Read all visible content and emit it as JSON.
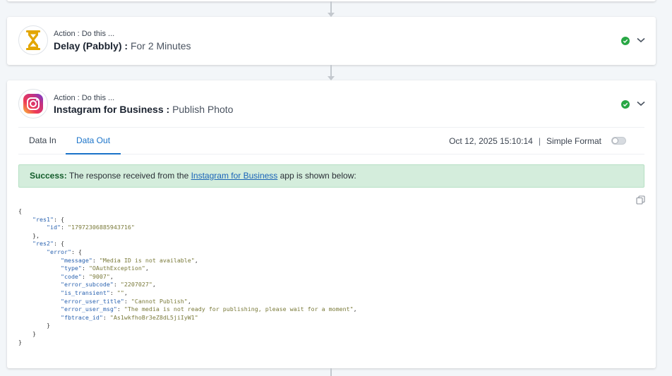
{
  "steps": [
    {
      "kicker": "Action : Do this ...",
      "app_name": "Delay (Pabbly)",
      "separator": " : ",
      "action_name": "For 2 Minutes",
      "icon": "hourglass-icon",
      "status": "success"
    },
    {
      "kicker": "Action : Do this ...",
      "app_name": "Instagram for Business",
      "separator": " : ",
      "action_name": "Publish Photo",
      "icon": "instagram-icon",
      "status": "success"
    }
  ],
  "tabs": [
    {
      "label": "Data In",
      "active": false
    },
    {
      "label": "Data Out",
      "active": true
    }
  ],
  "meta": {
    "timestamp": "Oct 12, 2025 15:10:14",
    "separator": "|",
    "format_label": "Simple Format",
    "simple_format_on": false
  },
  "alert": {
    "lead": "Success:",
    "text_before": " The response received from the ",
    "link": "Instagram for Business",
    "text_after": " app is shown below:"
  },
  "response": [
    {
      "indent": 0,
      "text": "{"
    },
    {
      "indent": 1,
      "key": "res1",
      "text": ": {"
    },
    {
      "indent": 2,
      "key": "id",
      "value": "17972306885943716"
    },
    {
      "indent": 1,
      "text": "},"
    },
    {
      "indent": 1,
      "key": "res2",
      "text": ": {"
    },
    {
      "indent": 2,
      "key": "error",
      "text": ": {"
    },
    {
      "indent": 3,
      "key": "message",
      "value": "Media ID is not available",
      "comma": true
    },
    {
      "indent": 3,
      "key": "type",
      "value": "OAuthException",
      "comma": true
    },
    {
      "indent": 3,
      "key": "code",
      "value": "9007",
      "comma": true
    },
    {
      "indent": 3,
      "key": "error_subcode",
      "value": "2207027",
      "comma": true
    },
    {
      "indent": 3,
      "key": "is_transient",
      "value": "",
      "comma": true
    },
    {
      "indent": 3,
      "key": "error_user_title",
      "value": "Cannot Publish",
      "comma": true
    },
    {
      "indent": 3,
      "key": "error_user_msg",
      "value": "The media is not ready for publishing, please wait for a moment",
      "comma": true
    },
    {
      "indent": 3,
      "key": "fbtrace_id",
      "value": "As1wkfhoBr3eZ8dL5jiIyW1"
    },
    {
      "indent": 2,
      "text": "}"
    },
    {
      "indent": 1,
      "text": "}"
    },
    {
      "indent": 0,
      "text": "}"
    }
  ],
  "colors": {
    "accent": "#1a73c9",
    "success": "#28a745",
    "alert_bg": "#d4eddc"
  }
}
